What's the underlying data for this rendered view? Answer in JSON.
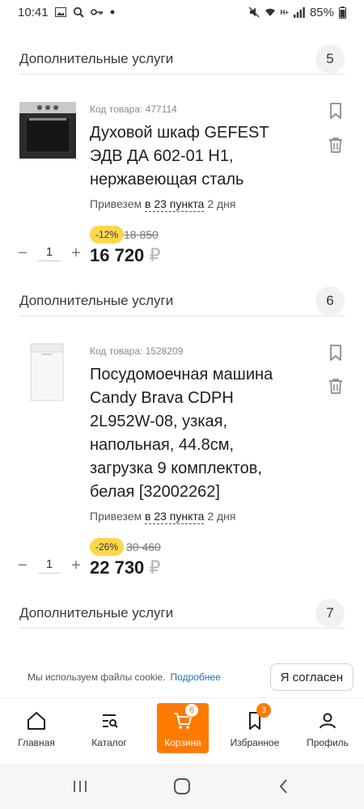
{
  "status_bar": {
    "time": "10:41",
    "battery": "85%",
    "net_label": "H+"
  },
  "sections": [
    {
      "label": "Дополнительные услуги",
      "count": "5"
    },
    {
      "label": "Дополнительные услуги",
      "count": "6"
    },
    {
      "label": "Дополнительные услуги",
      "count": "7"
    }
  ],
  "products": [
    {
      "code": "Код товара: 477114",
      "name": "Духовой шкаф GEFEST ЭДВ ДА 602-01 Н1, нержавеющая сталь",
      "delivery_prefix": "Привезем",
      "delivery_link": "в 23 пункта",
      "delivery_suffix": "2 дня",
      "discount": "-12%",
      "old_price": "18 850",
      "price": "16 720",
      "currency": "₽",
      "qty": "1"
    },
    {
      "code": "Код товара: 1528209",
      "name": "Посудомоечная машина Candy Brava CDPH 2L952W-08, узкая, напольная, 44.8см, загрузка 9 комплектов, белая [32002262]",
      "delivery_prefix": "Привезем",
      "delivery_link": "в 23 пункта",
      "delivery_suffix": "2 дня",
      "discount": "-26%",
      "old_price": "30 460",
      "price": "22 730",
      "currency": "₽",
      "qty": "1"
    }
  ],
  "qty_controls": {
    "minus": "−",
    "plus": "+"
  },
  "cookie": {
    "text": "Мы используем файлы cookie.",
    "more": "Подробнее",
    "accept": "Я согласен"
  },
  "nav": {
    "home": "Главная",
    "catalog": "Каталог",
    "cart": "Корзина",
    "cart_count": "6",
    "favorites": "Избранное",
    "favorites_count": "3",
    "profile": "Профиль"
  },
  "colors": {
    "accent": "#ff7a00",
    "discount_badge": "#ffd64a",
    "link": "#1d6fb5"
  }
}
